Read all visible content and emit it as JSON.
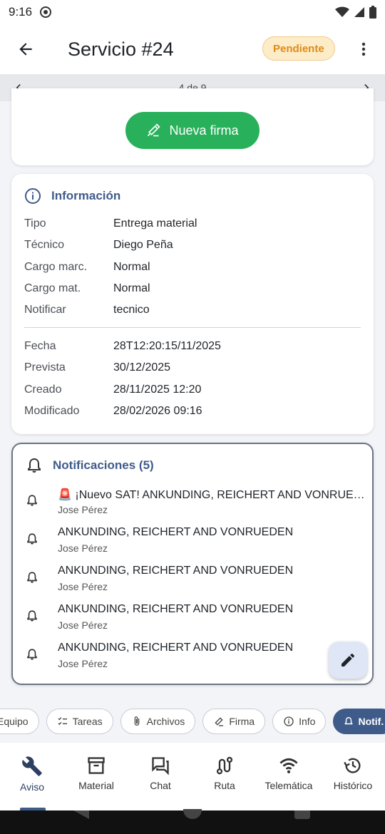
{
  "status_bar": {
    "time": "9:16"
  },
  "app_bar": {
    "title": "Servicio #24",
    "status": "Pendiente"
  },
  "pager": {
    "text": "4 de 9"
  },
  "firma": {
    "button_label": "Nueva firma"
  },
  "info": {
    "title": "Información",
    "rows": [
      {
        "label": "Tipo",
        "value": "Entrega material"
      },
      {
        "label": "Técnico",
        "value": "Diego Peña"
      },
      {
        "label": "Cargo marc.",
        "value": "Normal"
      },
      {
        "label": "Cargo mat.",
        "value": "Normal"
      },
      {
        "label": "Notificar",
        "value": "tecnico"
      }
    ],
    "dates": [
      {
        "label": "Fecha",
        "value": "28T12:20:15/11/2025"
      },
      {
        "label": "Prevista",
        "value": "30/12/2025"
      },
      {
        "label": "Creado",
        "value": "28/11/2025 12:20"
      },
      {
        "label": "Modificado",
        "value": "28/02/2026 09:16"
      }
    ]
  },
  "notifications": {
    "title": "Notificaciones (5)",
    "items": [
      {
        "title": "🚨 ¡Nuevo SAT! ANKUNDING, REICHERT AND VONRUEDEN",
        "author": "Jose Pérez"
      },
      {
        "title": "ANKUNDING, REICHERT AND VONRUEDEN",
        "author": "Jose Pérez"
      },
      {
        "title": "ANKUNDING, REICHERT AND VONRUEDEN",
        "author": "Jose Pérez"
      },
      {
        "title": "ANKUNDING, REICHERT AND VONRUEDEN",
        "author": "Jose Pérez"
      },
      {
        "title": "ANKUNDING, REICHERT AND VONRUEDEN",
        "author": "Jose Pérez"
      }
    ]
  },
  "chips": {
    "equipo": "Equipo",
    "tareas": "Tareas",
    "archivos": "Archivos",
    "firma": "Firma",
    "info": "Info",
    "notif": "Notif."
  },
  "bottom_nav": {
    "aviso": "Aviso",
    "material": "Material",
    "chat": "Chat",
    "ruta": "Ruta",
    "telematica": "Telemática",
    "historico": "Histórico"
  },
  "colors": {
    "accent": "#3f5b8a",
    "success": "#28b15a",
    "warning_bg": "#fdecc8",
    "warning_text": "#e08a16"
  }
}
